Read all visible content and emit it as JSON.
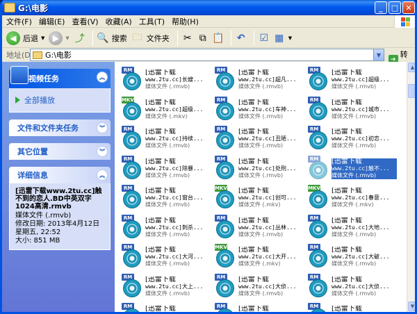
{
  "window": {
    "title": "G:\\电影"
  },
  "menu": [
    "文件(F)",
    "编辑(E)",
    "查看(V)",
    "收藏(A)",
    "工具(T)",
    "帮助(H)"
  ],
  "toolbar": {
    "back": "后退",
    "search": "搜索",
    "folders": "文件夹"
  },
  "address": {
    "label": "地址(D)",
    "value": "G:\\电影",
    "go": "转到"
  },
  "tasks": {
    "video_title": "视频任务",
    "play_all": "全部播放",
    "file_folder_tasks": "文件和文件夹任务",
    "other_places": "其它位置",
    "details_title": "详细信息",
    "details": {
      "name": "[迅雷下载www.2tu.cc]触不到的恋人.BD中英双字1024高清.rmvb",
      "type": "媒体文件 (.rmvb)",
      "modified": "修改日期: 2013年4月12日星期五, 22:52",
      "size": "大小: 851 MB"
    }
  },
  "files": [
    {
      "badge": "RM",
      "l1": "[迅雷下载",
      "l2": "www.2tu.cc]长嫂...",
      "l3": "媒体文件 (.rmvb)"
    },
    {
      "badge": "RM",
      "l1": "[迅雷下载",
      "l2": "www.2tu.cc]超凡...",
      "l3": "媒体文件 (.rmvb)"
    },
    {
      "badge": "RM",
      "l1": "[迅雷下载",
      "l2": "www.2tu.cc]超级...",
      "l3": "媒体文件 (.rmvb)"
    },
    {
      "badge": "MKV",
      "l1": "[迅雷下载",
      "l2": "www.2tu.cc]超级...",
      "l3": "媒体文件 (.mkv)"
    },
    {
      "badge": "RM",
      "l1": "[迅雷下载",
      "l2": "www.2tu.cc]车神...",
      "l3": "媒体文件 (.rmvb)"
    },
    {
      "badge": "RM",
      "l1": "[迅雷下载",
      "l2": "www.2tu.cc]城市...",
      "l3": "媒体文件 (.rmvb)"
    },
    {
      "badge": "RM",
      "l1": "[迅雷下载",
      "l2": "www.2tu.cc]持续...",
      "l3": "媒体文件 (.rmvb)"
    },
    {
      "badge": "RM",
      "l1": "[迅雷下载",
      "l2": "www.2tu.cc]丑陋...",
      "l3": "媒体文件 (.rmvb)"
    },
    {
      "badge": "RM",
      "l1": "[迅雷下载",
      "l2": "www.2tu.cc]初恋...",
      "l3": "媒体文件 (.rmvb)"
    },
    {
      "badge": "RM",
      "l1": "[迅雷下载",
      "l2": "www.2tu.cc]除暴...",
      "l3": "媒体文件 (.rmvb)"
    },
    {
      "badge": "RM",
      "l1": "[迅雷下载",
      "l2": "www.2tu.cc]处刑...",
      "l3": "媒体文件 (.rmvb)"
    },
    {
      "badge": "RM",
      "l1": "[迅雷下载",
      "l2": "www.2tu.cc]触不...",
      "l3": "媒体文件 (.rmvb)",
      "selected": true
    },
    {
      "badge": "RM",
      "l1": "[迅雷下载",
      "l2": "www.2tu.cc]窗台...",
      "l3": "媒体文件 (.rmvb)"
    },
    {
      "badge": "MKV",
      "l1": "[迅雷下载",
      "l2": "www.2tu.cc]创可...",
      "l3": "媒体文件 (.mkv)"
    },
    {
      "badge": "MKV",
      "l1": "[迅雷下载",
      "l2": "www.2tu.cc]春意...",
      "l3": "媒体文件 (.mkv)"
    },
    {
      "badge": "RM",
      "l1": "[迅雷下载",
      "l2": "www.2tu.cc]刺杀...",
      "l3": "媒体文件 (.rmvb)"
    },
    {
      "badge": "RM",
      "l1": "[迅雷下载",
      "l2": "www.2tu.cc]丛林...",
      "l3": "媒体文件 (.rmvb)"
    },
    {
      "badge": "RM",
      "l1": "[迅雷下载",
      "l2": "www.2tu.cc]大地...",
      "l3": "媒体文件 (.rmvb)"
    },
    {
      "badge": "RM",
      "l1": "[迅雷下载",
      "l2": "www.2tu.cc]大河...",
      "l3": "媒体文件 (.rmvb)"
    },
    {
      "badge": "MKV",
      "l1": "[迅雷下载",
      "l2": "www.2tu.cc]大开...",
      "l3": "媒体文件 (.mkv)"
    },
    {
      "badge": "RM",
      "l1": "[迅雷下载",
      "l2": "www.2tu.cc]大破...",
      "l3": "媒体文件 (.rmvb)"
    },
    {
      "badge": "RM",
      "l1": "[迅雷下载",
      "l2": "www.2tu.cc]大上...",
      "l3": "媒体文件 (.rmvb)"
    },
    {
      "badge": "RM",
      "l1": "[迅雷下载",
      "l2": "www.2tu.cc]大侦...",
      "l3": "媒体文件 (.rmvb)"
    },
    {
      "badge": "RM",
      "l1": "[迅雷下载",
      "l2": "www.2tu.cc]大侦...",
      "l3": "媒体文件 (.rmvb)"
    },
    {
      "badge": "RM",
      "l1": "[迅雷下载",
      "l2": "",
      "l3": ""
    },
    {
      "badge": "RM",
      "l1": "[迅雷下载",
      "l2": "",
      "l3": ""
    },
    {
      "badge": "RM",
      "l1": "[迅雷下载",
      "l2": "",
      "l3": ""
    }
  ],
  "colors": {
    "rm_badge": "#2f5fb5",
    "mkv_badge": "#3f9a3a",
    "selection": "#316ac5"
  }
}
